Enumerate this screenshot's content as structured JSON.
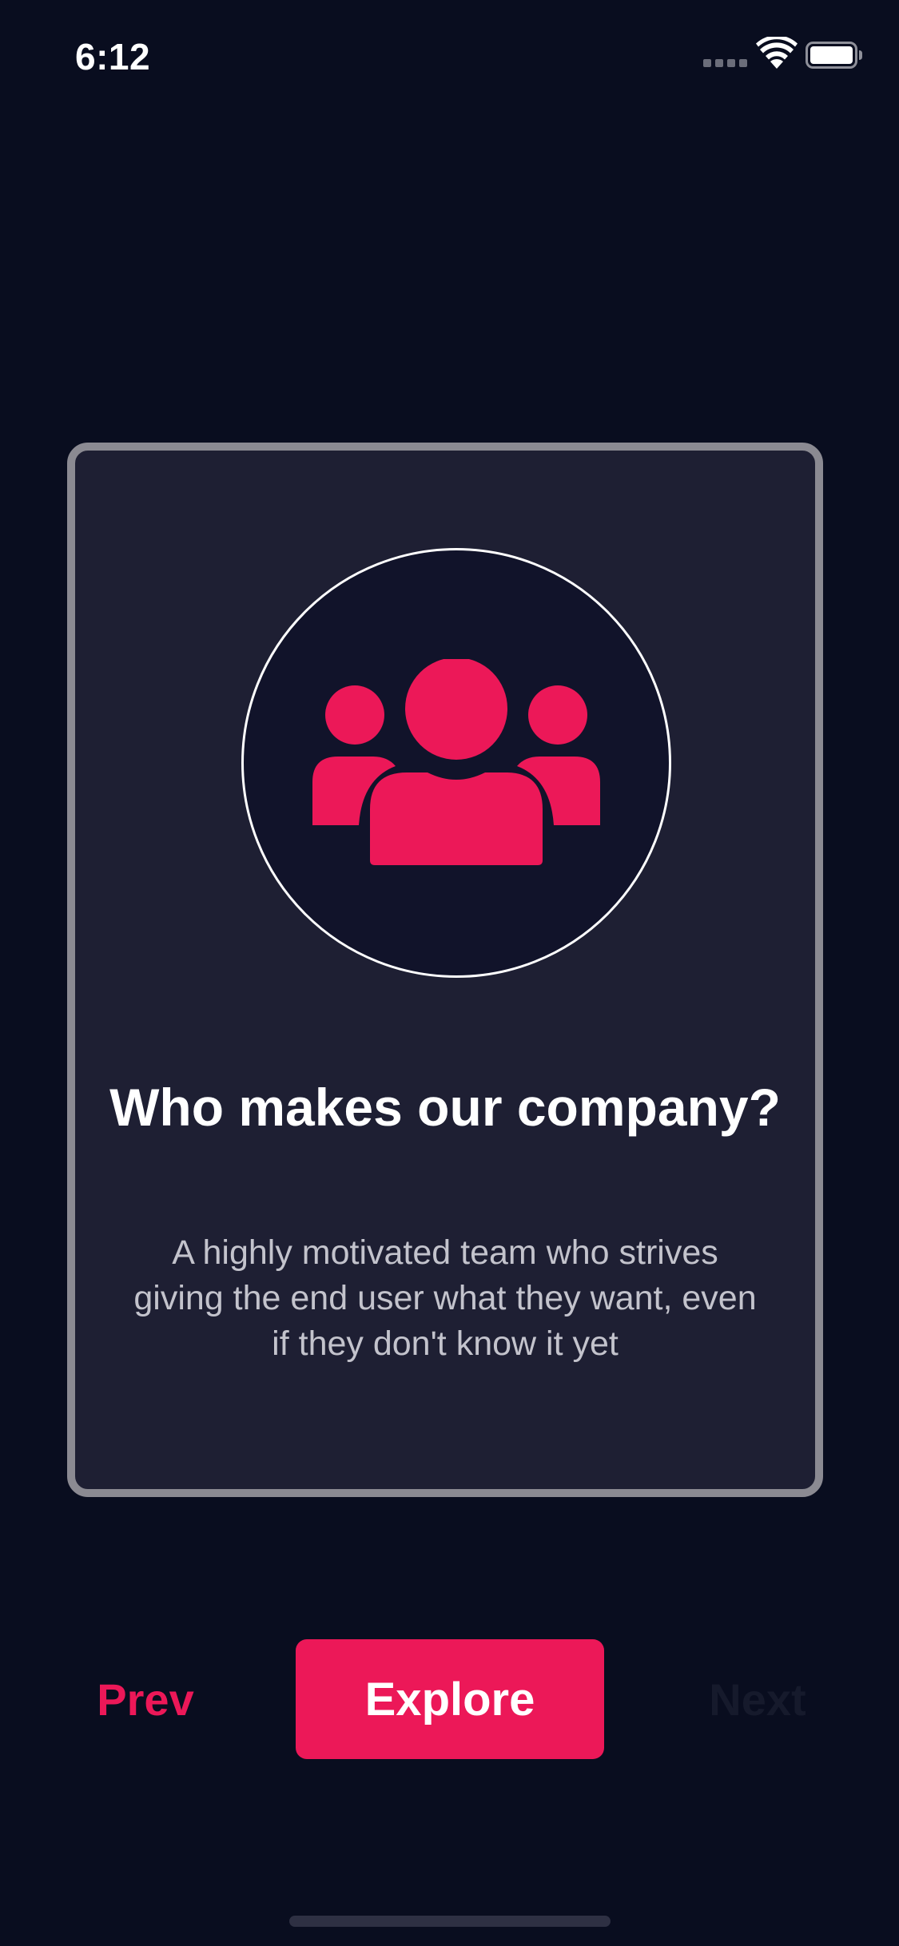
{
  "status_bar": {
    "time": "6:12",
    "icons": [
      "cellular-signal-icon",
      "wifi-icon",
      "battery-icon"
    ]
  },
  "card": {
    "icon": "team-icon",
    "title": "Who makes our company?",
    "description": "A highly motivated team who strives giving the end user what they want, even if they don't know it yet"
  },
  "navigation": {
    "prev_label": "Prev",
    "explore_label": "Explore",
    "next_label": "Next",
    "next_enabled": false
  },
  "colors": {
    "background": "#090d1f",
    "card_background": "#1e1f33",
    "card_border": "#8b8a92",
    "accent": "#ec1858",
    "text_primary": "#ffffff",
    "text_secondary": "#c3c3cc",
    "disabled_text": "#161a2c"
  }
}
